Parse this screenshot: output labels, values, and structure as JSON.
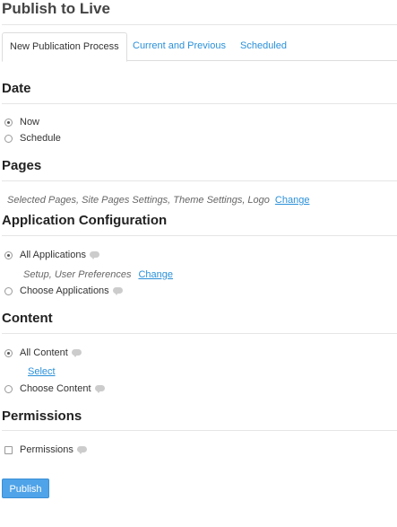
{
  "page": {
    "title": "Publish to Live"
  },
  "tabs": [
    {
      "label": "New Publication Process",
      "active": true
    },
    {
      "label": "Current and Previous",
      "active": false
    },
    {
      "label": "Scheduled",
      "active": false
    }
  ],
  "date": {
    "heading": "Date",
    "options": [
      {
        "label": "Now",
        "checked": true
      },
      {
        "label": "Schedule",
        "checked": false
      }
    ]
  },
  "pages": {
    "heading": "Pages",
    "summary": "Selected Pages, Site Pages Settings, Theme Settings, Logo",
    "change_label": "Change"
  },
  "app_config": {
    "heading": "Application Configuration",
    "all_label": "All Applications",
    "all_summary": "Setup, User Preferences",
    "change_label": "Change",
    "choose_label": "Choose Applications"
  },
  "content": {
    "heading": "Content",
    "all_label": "All Content",
    "select_label": "Select",
    "choose_label": "Choose Content"
  },
  "permissions": {
    "heading": "Permissions",
    "checkbox_label": "Permissions",
    "checked": false
  },
  "actions": {
    "publish_label": "Publish"
  },
  "colors": {
    "link": "#2b90d9",
    "primary_button": "#4fa3e8"
  },
  "icons": {
    "help": "help-bubble-icon"
  }
}
